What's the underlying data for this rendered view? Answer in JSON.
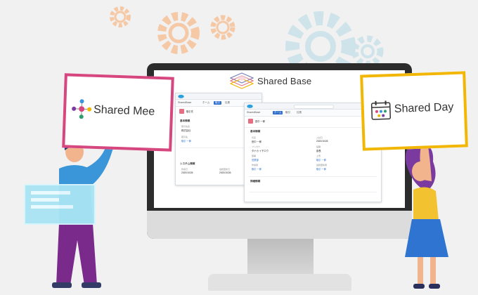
{
  "product": {
    "name": "Shared Base"
  },
  "cards": {
    "left": {
      "label": "Shared Mee",
      "border_color": "#d6467f"
    },
    "right": {
      "label": "Shared Day",
      "border_color": "#f2b705"
    }
  },
  "screen": {
    "window_back": {
      "app_name": "SharedBase",
      "tabs": [
        "ホーム",
        "取引",
        "社員"
      ],
      "record_title": "取引先",
      "sections": [
        "基本情報",
        "システム情報"
      ],
      "fields": [
        {
          "label": "取引先名",
          "value": "株式会社"
        },
        {
          "label": "取引先",
          "value": "取引 一郎"
        },
        {
          "label": "作成日",
          "value": "2020/10/26"
        },
        {
          "label": "最終更新日",
          "value": "2020/10/26"
        }
      ]
    },
    "window_front": {
      "app_name": "SharedBase",
      "tabs": [
        "ホーム",
        "取引",
        "社員"
      ],
      "record_title": "田中 一郎",
      "sections": [
        "基本情報",
        "詳細情報"
      ],
      "fields": [
        {
          "label": "氏名",
          "value": "田中 一郎"
        },
        {
          "label": "入社日",
          "value": "2020/10/26"
        },
        {
          "label": "フリガナ",
          "value": "タナカ イチロウ"
        },
        {
          "label": "役職",
          "value": "部長"
        },
        {
          "label": "部署",
          "value": "営業部"
        },
        {
          "label": "上司",
          "value": "取引 一郎"
        },
        {
          "label": "作成者",
          "value": "取引 一郎"
        },
        {
          "label": "最終更新者",
          "value": "取引 一郎"
        }
      ]
    }
  },
  "colors": {
    "accent_blue": "#2f6fcb",
    "monitor_frame": "#2c2c2c",
    "shirt_blue": "#3a96d8",
    "pants_purple": "#7a2a8a",
    "hair_purple": "#7b3aa0",
    "top_yellow": "#f2c230",
    "gear_orange": "#f6c9a6",
    "gear_teal": "#cfe4ea"
  }
}
